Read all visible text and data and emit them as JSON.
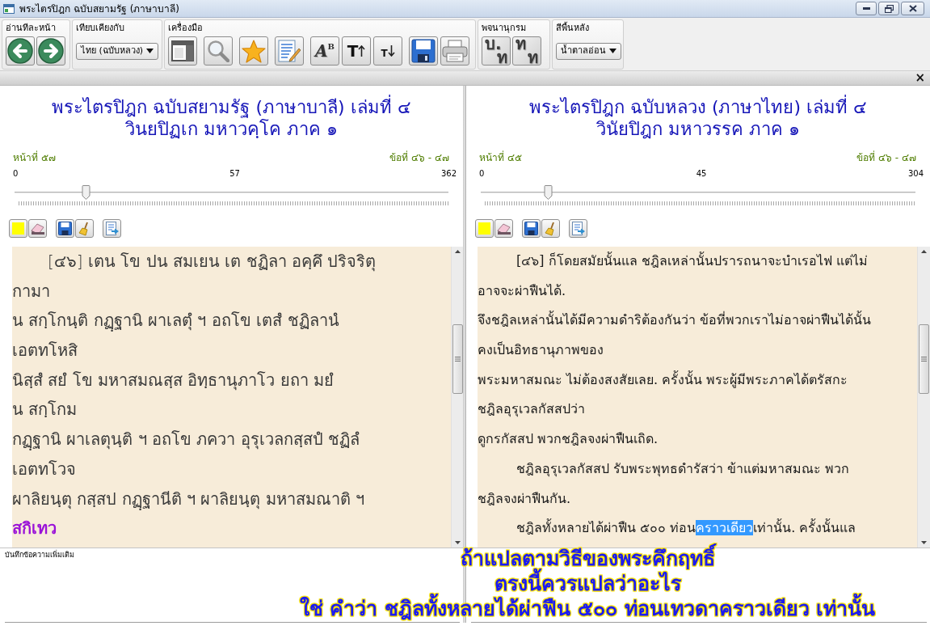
{
  "window": {
    "title": "พระไตรปิฎก ฉบับสยามรัฐ (ภาษาบาลี)"
  },
  "ribbon": [
    {
      "kind": "page_nav",
      "label": "อ่านทีละหน้า"
    },
    {
      "kind": "compare",
      "label": "เทียบเคียงกับ",
      "value": "ไทย (ฉบับหลวง)"
    },
    {
      "kind": "tools",
      "label": "เครื่องมือ",
      "font_glyphs": [
        "A",
        "B"
      ],
      "grow_glyph": "T",
      "shrink_glyph": "T"
    },
    {
      "kind": "dictionary",
      "label": "พจนานุกรม",
      "buttons": [
        {
          "source": "บ.",
          "target": "ท"
        },
        {
          "source": "ท",
          "target": "ท"
        }
      ]
    },
    {
      "kind": "background",
      "label": "สีพื้นหลัง",
      "value": "น้ำตาลอ่อน"
    }
  ],
  "pane_bar": {
    "close": "×"
  },
  "panes": [
    {
      "kind": "pali",
      "title_lines": [
        "พระไตรปิฎก ฉบับสยามรัฐ (ภาษาบาลี) เล่มที่ ๔",
        "วินยปิฏเก มหาวคฺโค ภาค ๑"
      ],
      "page": "หน้าที่ ๕๗",
      "items": "ข้อที่ ๔๖ - ๔๗",
      "slider": {
        "min": "0",
        "value": "57",
        "max": "362",
        "level": 0.157
      },
      "lines": [
        {
          "text": "[๔๖] เตน โข ปน สมเยน เต ชฏิลา อคฺคึ ปริจริตุ",
          "indent": true,
          "emphasis": false
        },
        {
          "text": "กามา",
          "indent": false,
          "emphasis": false
        },
        {
          "text": "น สกฺโกนฺติ กฏฺฐานิ ผาเลตุํ ฯ อถโข เตสํ ชฏิลานํ",
          "indent": false,
          "emphasis": false
        },
        {
          "text": "เอตทโหสิ",
          "indent": false,
          "emphasis": false
        },
        {
          "text": "นิสฺสํ สยํ โข มหาสมณสฺส อิทฺธานุภาโว ยถา มยํ",
          "indent": false,
          "emphasis": false
        },
        {
          "text": "น สกฺโกม",
          "indent": false,
          "emphasis": false
        },
        {
          "text": "กฏฺฐานิ ผาเลตุนฺติ ฯ อถโข ภควา อุรุเวลกสฺสปํ ชฏิลํ",
          "indent": false,
          "emphasis": false
        },
        {
          "text": "เอตทโวจ",
          "indent": false,
          "emphasis": false
        },
        {
          "text": "ผาลิยนฺตุ กสฺสป กฏฺฐานีติ ฯ ผาลิยนฺตุ มหาสมณาติ ฯ",
          "indent": false,
          "emphasis": false
        },
        {
          "text": "สกิเทว",
          "indent": false,
          "emphasis": true
        }
      ],
      "notes_label": "บันทึกข้อความเพิ่มเติม"
    },
    {
      "kind": "thai",
      "title_lines": [
        "พระไตรปิฎก ฉบับหลวง (ภาษาไทย) เล่มที่ ๔",
        "วินัยปิฎก มหาวรรค ภาค ๑"
      ],
      "page": "หน้าที่ ๔๕",
      "items": "ข้อที่ ๔๖ - ๔๗",
      "slider": {
        "min": "0",
        "value": "45",
        "max": "304",
        "level": 0.148
      },
      "lines": [
        {
          "text": "[๔๖] ก็โดยสมัยนั้นแล ชฎิลเหล่านั้นปรารถนาจะบำเรอไฟ แต่ไม่",
          "indent": true,
          "emphasis": false
        },
        {
          "text": "อาจจะผ่าฟืนได้.",
          "indent": false,
          "emphasis": false
        },
        {
          "text": "จึงชฎิลเหล่านั้นได้มีความดำริต้องกันว่า ข้อที่พวกเราไม่อาจผ่าฟืนได้นั้น",
          "indent": false,
          "emphasis": false
        },
        {
          "text": "คงเป็นอิทธานุภาพของ",
          "indent": false,
          "emphasis": false
        },
        {
          "text": "พระมหาสมณะ ไม่ต้องสงสัยเลย. ครั้งนั้น พระผู้มีพระภาคได้ตรัสกะ",
          "indent": false,
          "emphasis": false
        },
        {
          "text": "ชฎิลอุรุเวลกัสสปว่า",
          "indent": false,
          "emphasis": false
        },
        {
          "text": "ดูกรกัสสป พวกชฎิลจงผ่าฟืนเถิด.",
          "indent": false,
          "emphasis": false
        },
        {
          "text": "ชฎิลอุรุเวลกัสสป รับพระพุทธดำรัสว่า ข้าแต่มหาสมณะ พวก",
          "indent": true,
          "emphasis": false
        },
        {
          "text": "ชฎิลจงผ่าฟืนกัน.",
          "indent": false,
          "emphasis": false
        },
        {
          "parts": [
            {
              "text": "ชฎิลทั้งหลายได้ผ่าฟืน ๕๐๐ ท่อน",
              "selected": false
            },
            {
              "text": "คราวเดียว",
              "selected": true
            },
            {
              "text": "เท่านั้น. ครั้งนั้นแล",
              "selected": false
            }
          ],
          "indent": true,
          "emphasis": false
        }
      ]
    }
  ],
  "annotation": {
    "lines": [
      "ถ้าแปลตามวิธีของพระคึกฤทธิ์",
      "ตรงนี้ควรแปลว่าอะไร",
      "ใช่ คำว่า ชฎิลทั้งหลายได้ผ่าฟืน ๕๐๐ ท่อนเทวดาคราวเดียว เท่านั้น"
    ]
  }
}
